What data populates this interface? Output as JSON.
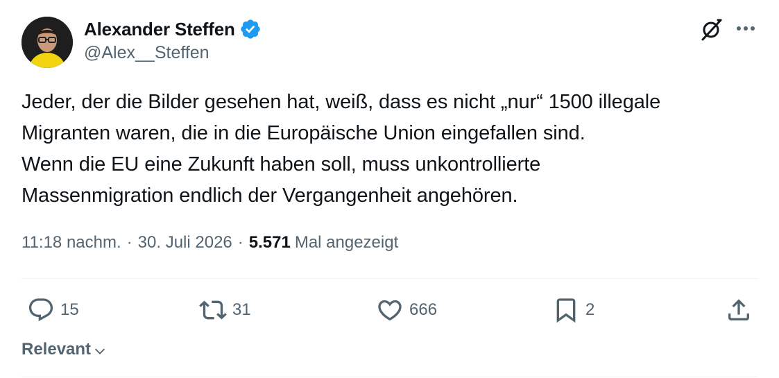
{
  "author": {
    "display_name": "Alexander Steffen",
    "handle": "@Alex__Steffen",
    "verified": true,
    "verified_color": "#1d9bf0"
  },
  "header_icons": {
    "grok": "grok-icon",
    "more": "more-horizontal-icon"
  },
  "tweet": {
    "text": "Jeder, der die Bilder gesehen hat, weiß, dass es nicht „nur“ 1500 illegale\nMigranten waren, die in die Europäische Union eingefallen sind.\nWenn die EU eine Zukunft haben soll, muss unkontrollierte\nMassenmigration endlich der Vergangenheit angehören."
  },
  "meta": {
    "time": "11:18 nachm.",
    "separator": "·",
    "date": "30. Juli 2026",
    "views_count": "5.571",
    "views_label": "Mal angezeigt"
  },
  "actions": {
    "reply": {
      "icon": "reply-icon",
      "count": "15"
    },
    "retweet": {
      "icon": "retweet-icon",
      "count": "31"
    },
    "like": {
      "icon": "heart-icon",
      "count": "666"
    },
    "bookmark": {
      "icon": "bookmark-icon",
      "count": "2"
    },
    "share": {
      "icon": "share-icon"
    }
  },
  "sort": {
    "label": "Relevant",
    "icon": "chevron-down-icon"
  },
  "colors": {
    "text_primary": "#0f1419",
    "text_secondary": "#536471",
    "divider": "#eff3f4",
    "accent": "#1d9bf0"
  }
}
